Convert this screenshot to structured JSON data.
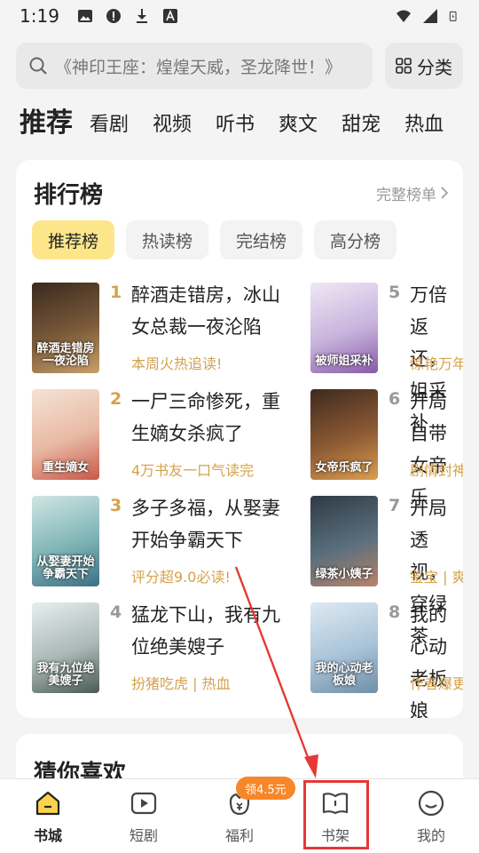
{
  "status_bar": {
    "time": "1:19"
  },
  "search": {
    "placeholder": "《神印王座：煌煌天威，圣龙降世！》",
    "category_label": "分类"
  },
  "tabs": [
    "推荐",
    "看剧",
    "视频",
    "听书",
    "爽文",
    "甜宠",
    "热血"
  ],
  "ranking": {
    "title": "排行榜",
    "more_label": "完整榜单",
    "tabs": [
      "推荐榜",
      "热读榜",
      "完结榜",
      "高分榜"
    ],
    "books": [
      {
        "rank": "1",
        "name": "醉酒走错房，冰山女总裁一夜沦陷",
        "tag": "本周火热追读!",
        "cover_text": "醉酒走错房一夜沦陷"
      },
      {
        "rank": "2",
        "name": "一尸三命惨死，重生嫡女杀疯了",
        "tag": "4万书友一口气读完",
        "cover_text": "重生嫡女"
      },
      {
        "rank": "3",
        "name": "多子多福，从娶妻开始争霸天下",
        "tag": "评分超9.0必读!",
        "cover_text": "从娶妻开始争霸天下"
      },
      {
        "rank": "4",
        "name": "猛龙下山，我有九位绝美嫂子",
        "tag": "扮猪吃虎 | 热血",
        "cover_text": "我有九位绝美嫂子"
      },
      {
        "rank": "5",
        "name": "万倍返还，姐采补",
        "tag": "惊艳万年",
        "cover_text": "被师姐采补"
      },
      {
        "rank": "6",
        "name": "开局自带女帝乐",
        "tag": "剧情封神",
        "cover_text": "女帝乐疯了"
      },
      {
        "rank": "7",
        "name": "开局透视，穿绿茶",
        "tag": "鉴宝 | 爽",
        "cover_text": "绿茶小姨子"
      },
      {
        "rank": "8",
        "name": "我的心动老板娘",
        "tag": "作者爆更",
        "cover_text": "我的心动老板娘"
      }
    ]
  },
  "guess": {
    "title": "猜你喜欢"
  },
  "bottom_nav": {
    "items": [
      {
        "label": "书城",
        "icon": "home-icon"
      },
      {
        "label": "短剧",
        "icon": "play-icon"
      },
      {
        "label": "福利",
        "icon": "gift-icon"
      },
      {
        "label": "书架",
        "icon": "bookshelf-icon"
      },
      {
        "label": "我的",
        "icon": "profile-icon"
      }
    ],
    "badge": "领4.5元"
  },
  "colors": {
    "accent_yellow": "#fde68a",
    "gold_text": "#d4a24c",
    "badge_orange": "#f6872a",
    "annotation_red": "#e53935"
  }
}
